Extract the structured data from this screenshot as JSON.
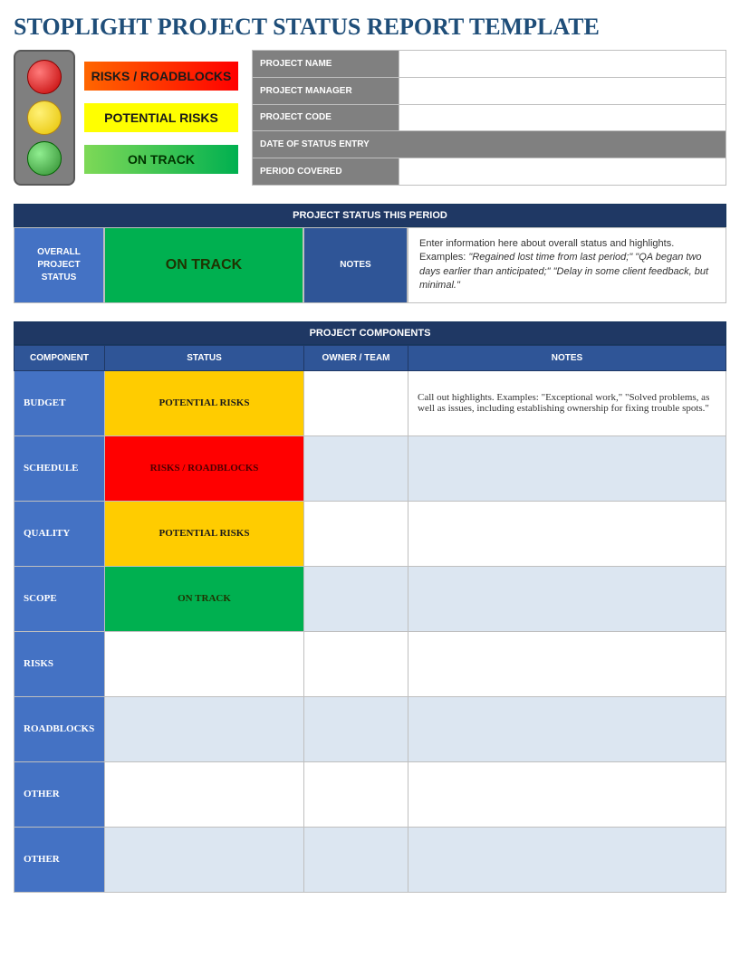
{
  "title": "STOPLIGHT PROJECT STATUS REPORT TEMPLATE",
  "legend": {
    "red": "RISKS / ROADBLOCKS",
    "yellow": "POTENTIAL RISKS",
    "green": "ON TRACK"
  },
  "meta": {
    "rows": [
      {
        "label": "PROJECT NAME",
        "value": ""
      },
      {
        "label": "PROJECT MANAGER",
        "value": ""
      },
      {
        "label": "PROJECT CODE",
        "value": ""
      },
      {
        "label": "DATE OF STATUS ENTRY",
        "full": true
      },
      {
        "label": "PERIOD COVERED",
        "value": ""
      }
    ]
  },
  "period": {
    "header": "PROJECT STATUS THIS PERIOD",
    "overall_label": "OVERALL PROJECT STATUS",
    "overall_status": "ON TRACK",
    "notes_label": "NOTES",
    "notes_lead": "Enter information here about overall status and highlights. Examples: ",
    "notes_hint": "\"Regained lost time from last period;\" \"QA began two days earlier than anticipated;\" \"Delay in some client feedback, but minimal.\""
  },
  "components": {
    "header": "PROJECT COMPONENTS",
    "cols": {
      "component": "COMPONENT",
      "status": "STATUS",
      "owner": "OWNER / TEAM",
      "notes": "NOTES"
    },
    "rows": [
      {
        "label": "BUDGET",
        "status": "POTENTIAL RISKS",
        "status_class": "status-yellow",
        "owner": "",
        "notes": "Call out highlights. Examples: \"Exceptional work,\" \"Solved problems, as well as issues, including establishing ownership for fixing trouble spots.\"",
        "alt": false
      },
      {
        "label": "SCHEDULE",
        "status": "RISKS / ROADBLOCKS",
        "status_class": "status-red",
        "owner": "",
        "notes": "",
        "alt": true
      },
      {
        "label": "QUALITY",
        "status": "POTENTIAL RISKS",
        "status_class": "status-yellow",
        "owner": "",
        "notes": "",
        "alt": false
      },
      {
        "label": "SCOPE",
        "status": "ON TRACK",
        "status_class": "status-green",
        "owner": "",
        "notes": "",
        "alt": true
      },
      {
        "label": "RISKS",
        "status": "",
        "status_class": "",
        "owner": "",
        "notes": "",
        "alt": false
      },
      {
        "label": "ROADBLOCKS",
        "status": "",
        "status_class": "",
        "owner": "",
        "notes": "",
        "alt": true
      },
      {
        "label": "OTHER",
        "status": "",
        "status_class": "",
        "owner": "",
        "notes": "",
        "alt": false
      },
      {
        "label": "OTHER",
        "status": "",
        "status_class": "",
        "owner": "",
        "notes": "",
        "alt": true
      }
    ]
  }
}
